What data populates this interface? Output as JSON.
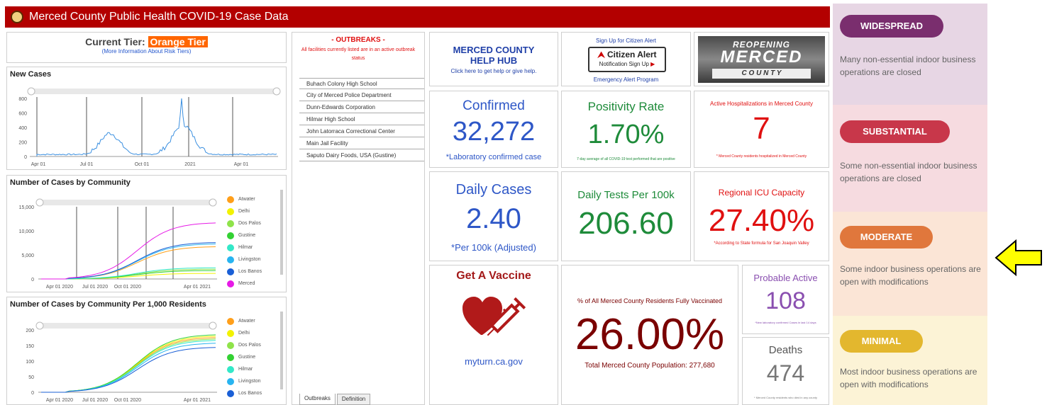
{
  "header": {
    "title": "Merced County Public Health COVID-19 Case Data"
  },
  "tier": {
    "label": "Current Tier:",
    "value": "Orange Tier",
    "more_info": "(More Information About Risk Tiers)"
  },
  "new_cases": {
    "title": "New Cases",
    "y_ticks": [
      "800",
      "600",
      "400",
      "200",
      "0"
    ],
    "x_ticks": [
      "Apr 01",
      "Jul 01",
      "Oct 01",
      "2021",
      "Apr 01"
    ]
  },
  "community_cases": {
    "title": "Number of Cases by Community",
    "y_ticks": [
      "15,000",
      "10,000",
      "5,000",
      "0"
    ],
    "x_ticks": [
      "Apr 01 2020",
      "Jul 01 2020",
      "Oct 01 2020",
      "Apr 01 2021"
    ],
    "legend": [
      {
        "name": "Atwater",
        "color": "#ff9f1a"
      },
      {
        "name": "Delhi",
        "color": "#f2f200"
      },
      {
        "name": "Dos Palos",
        "color": "#8fe34a"
      },
      {
        "name": "Gustine",
        "color": "#33d133"
      },
      {
        "name": "Hilmar",
        "color": "#33e8c8"
      },
      {
        "name": "Livingston",
        "color": "#28b4f0"
      },
      {
        "name": "Los Banos",
        "color": "#1a5fd6"
      },
      {
        "name": "Merced",
        "color": "#e61ae6"
      }
    ]
  },
  "community_per_1000": {
    "title": "Number of Cases by Community Per 1,000 Residents",
    "y_ticks": [
      "200",
      "150",
      "100",
      "50",
      "0"
    ],
    "x_ticks": [
      "Apr 01 2020",
      "Jul 01 2020",
      "Oct 01 2020",
      "Apr 01 2021"
    ],
    "legend": [
      {
        "name": "Atwater",
        "color": "#ff9f1a"
      },
      {
        "name": "Delhi",
        "color": "#f2f200"
      },
      {
        "name": "Dos Palos",
        "color": "#8fe34a"
      },
      {
        "name": "Gustine",
        "color": "#33d133"
      },
      {
        "name": "Hilmar",
        "color": "#33e8c8"
      },
      {
        "name": "Livingston",
        "color": "#28b4f0"
      },
      {
        "name": "Los Banos",
        "color": "#1a5fd6"
      }
    ]
  },
  "outbreaks": {
    "title": "- OUTBREAKS -",
    "subtitle": "All facilities currently listed are in an active outbreak status",
    "items": [
      "Buhach Colony High School",
      "City of Merced Police Department",
      "Dunn-Edwards Corporation",
      "Hilmar High School",
      "John Latorraca Correctional Center",
      "Main Jail Facility",
      "Saputo Dairy Foods, USA (Gustine)"
    ],
    "tabs": [
      "Outbreaks",
      "Definition"
    ]
  },
  "help_hub": {
    "title": "MERCED COUNTY HELP HUB",
    "subtitle": "Click here to get help or give help."
  },
  "citizen_alert": {
    "top": "Sign Up for Citizen Alert",
    "brand": "Citizen Alert",
    "signup": "Notification Sign Up",
    "bottom": "Emergency Alert Program"
  },
  "reopening": {
    "line1": "REOPENING",
    "line2": "MERCED",
    "line3": "C O U N T Y"
  },
  "confirmed": {
    "title": "Confirmed",
    "value": "32,272",
    "note": "*Laboratory confirmed case"
  },
  "positivity": {
    "title": "Positivity Rate",
    "value": "1.70%",
    "note": "7-day average of all COVID-19 test performed that are positive"
  },
  "hospitalizations": {
    "title": "Active Hospitalizations in Merced County",
    "value": "7",
    "note": "* Merced County residents hospitalized in Merced County"
  },
  "daily_cases": {
    "title": "Daily Cases",
    "value": "2.40",
    "note": "*Per 100k (Adjusted)"
  },
  "daily_tests": {
    "title": "Daily Tests Per 100k",
    "value": "206.60"
  },
  "icu": {
    "title": "Regional ICU Capacity",
    "value": "27.40%",
    "note": "*According to State formula for San Joaquin Valley"
  },
  "vaccine": {
    "title": "Get A Vaccine",
    "link": "myturn.ca.gov"
  },
  "vaccinated": {
    "title": "% of All Merced County Residents Fully Vaccinated",
    "value": "26.00%",
    "population": "Total Merced County Population: 277,680"
  },
  "probable": {
    "title": "Probable Active",
    "value": "108",
    "note": "*New laboratory confirmed Cases in last 14 days"
  },
  "deaths": {
    "title": "Deaths",
    "value": "474",
    "note": "* Merced County residents who died in any county"
  },
  "tiers": [
    {
      "label": "WIDESPREAD",
      "desc": "Many non-essential indoor business operations are closed",
      "color": "#7a2e6e",
      "bg": "#e7d6e4"
    },
    {
      "label": "SUBSTANTIAL",
      "desc": "Some non-essential indoor business operations are closed",
      "color": "#c8374a",
      "bg": "#f6dbe0"
    },
    {
      "label": "MODERATE",
      "desc": "Some indoor business operations are open with modifications",
      "color": "#e0773c",
      "bg": "#fbe5d6"
    },
    {
      "label": "MINIMAL",
      "desc": "Most indoor business operations are open with modifications",
      "color": "#e3b72e",
      "bg": "#fcf3d6"
    }
  ],
  "colors": {
    "header_red": "#b30000",
    "tier_orange": "#ff6600",
    "blue_value": "#2e57c7",
    "green_value": "#1e8b3a",
    "red_value": "#e01010",
    "purple_value": "#8a4fb0",
    "dark_red": "#7a0000",
    "arrow_yellow": "#ffff00"
  }
}
